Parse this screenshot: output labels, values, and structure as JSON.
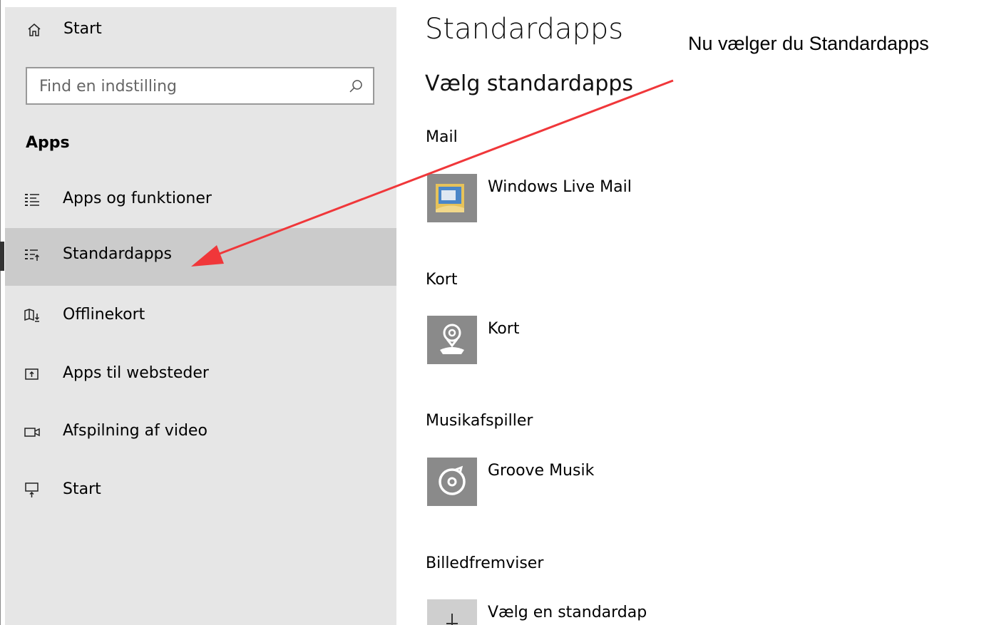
{
  "sidebar": {
    "home_label": "Start",
    "search_placeholder": "Find en indstilling",
    "section_heading": "Apps",
    "items": [
      {
        "label": "Apps og funktioner",
        "icon": "list-icon"
      },
      {
        "label": "Standardapps",
        "icon": "default-apps-icon",
        "selected": true
      },
      {
        "label": "Offlinekort",
        "icon": "offline-map-icon"
      },
      {
        "label": "Apps til websteder",
        "icon": "web-apps-icon"
      },
      {
        "label": "Afspilning af video",
        "icon": "video-icon"
      },
      {
        "label": "Start",
        "icon": "startup-icon"
      }
    ]
  },
  "main": {
    "title": "Standardapps",
    "subtitle": "Vælg standardapps",
    "categories": [
      {
        "label": "Mail",
        "app": "Windows Live Mail"
      },
      {
        "label": "Kort",
        "app": "Kort"
      },
      {
        "label": "Musikafspiller",
        "app": "Groove Musik"
      },
      {
        "label": "Billedfremviser",
        "app": "Vælg en standardap"
      }
    ]
  },
  "annotation": {
    "text": "Nu vælger du Standardapps",
    "arrow_color": "#f0373a"
  },
  "colors": {
    "sidebar_bg": "#e6e6e6",
    "selected_bg": "#cbcbcb",
    "tile_bg": "#8a8a8a"
  }
}
